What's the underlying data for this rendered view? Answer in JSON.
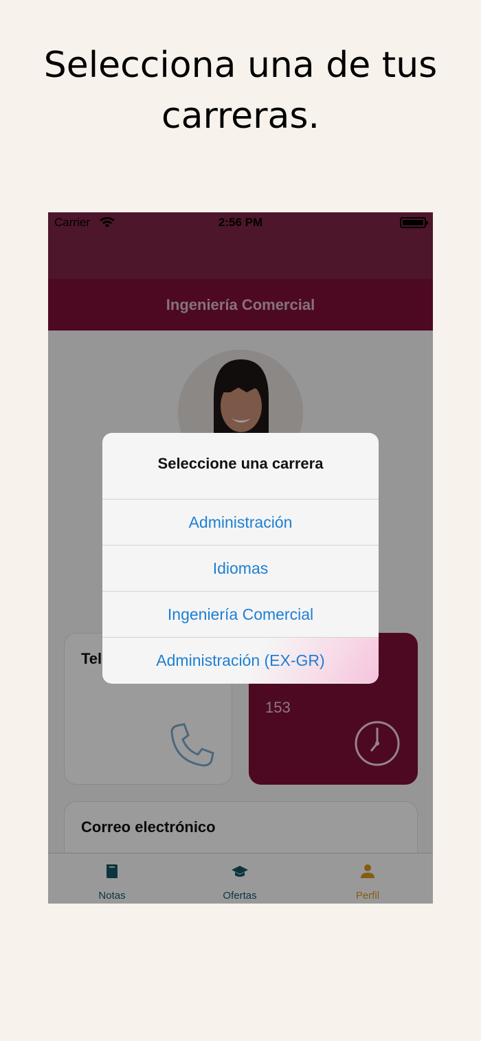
{
  "promo": {
    "title_line1": "Selecciona una de tus",
    "title_line2": "carreras."
  },
  "status_bar": {
    "carrier": "Carrier",
    "time": "2:56 PM"
  },
  "nav": {
    "title": "Ingeniería Comercial"
  },
  "cards": {
    "phone_title": "Tel",
    "service_value": "153",
    "email_title": "Correo electrónico"
  },
  "alert": {
    "title": "Seleccione una carrera",
    "options": [
      "Administración",
      "Idiomas",
      "Ingeniería Comercial",
      "Administración (EX-GR)"
    ]
  },
  "tabs": [
    {
      "label": "Notas",
      "icon": "book-icon",
      "color": "#155565"
    },
    {
      "label": "Ofertas",
      "icon": "graduation-cap-icon",
      "color": "#155565"
    },
    {
      "label": "Perfil",
      "icon": "person-icon",
      "color": "#d89420",
      "selected": true
    }
  ],
  "colors": {
    "status_bar": "#7c2444",
    "nav_bar": "#7e0f37",
    "accent": "#7e0f37",
    "link": "#1d7fd3",
    "selected_tab": "#d89420"
  }
}
